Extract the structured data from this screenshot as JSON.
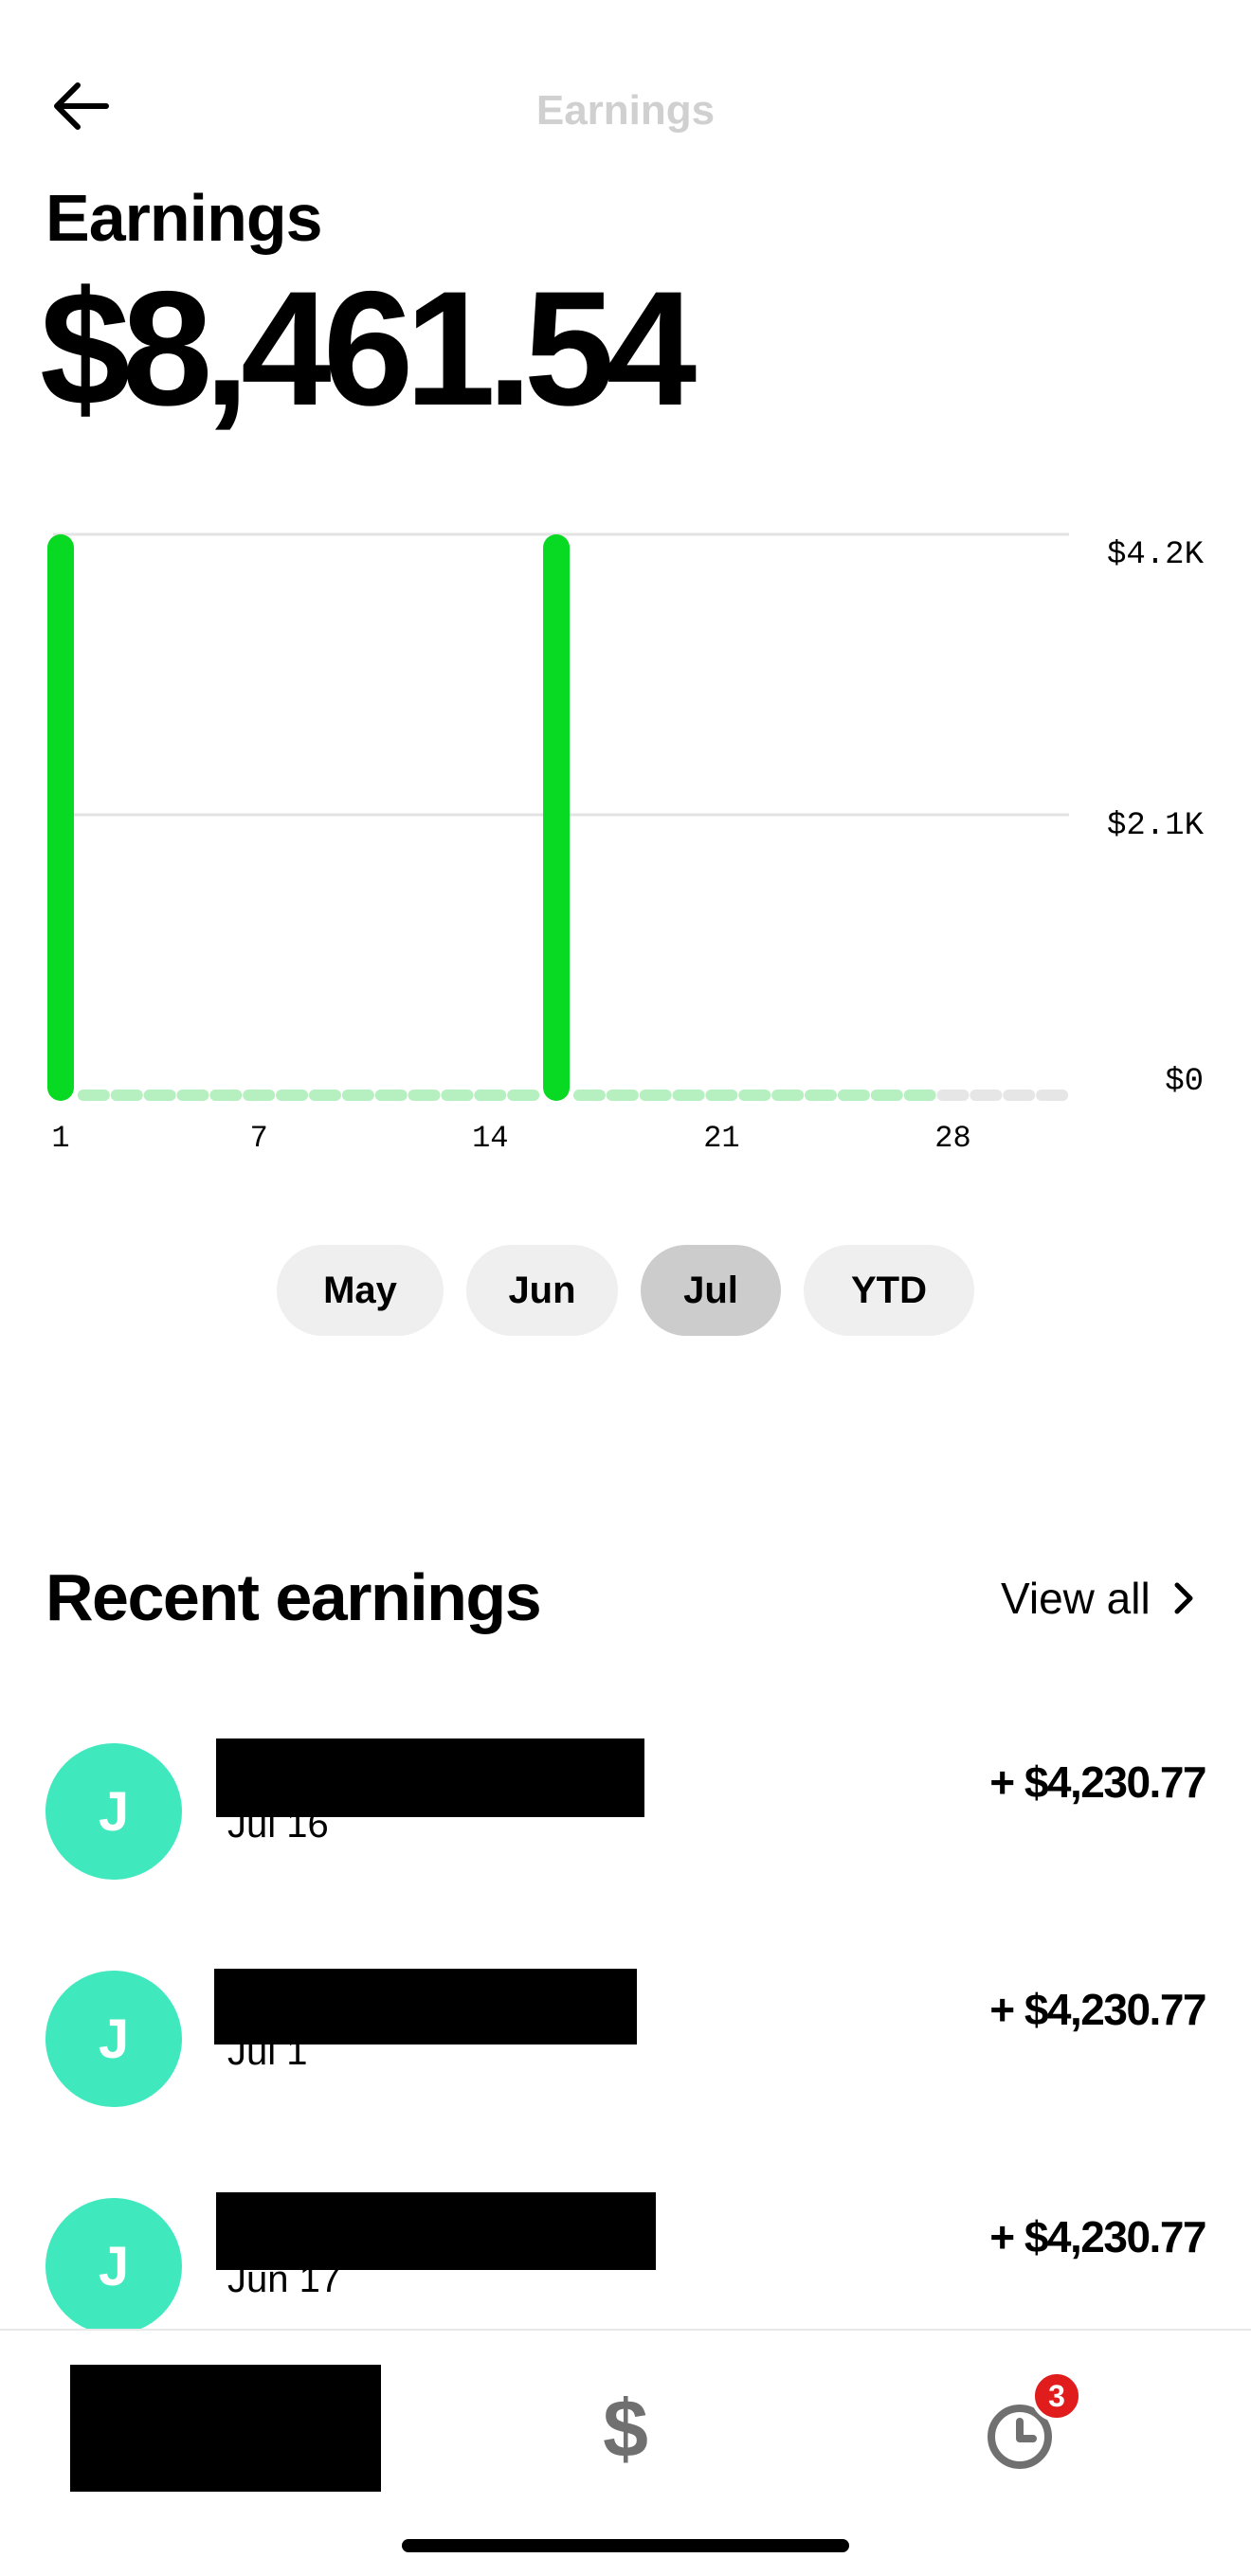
{
  "header": {
    "title": "Earnings"
  },
  "summary": {
    "label": "Earnings",
    "total": "$8,461.54"
  },
  "colors": {
    "bar": "#08d922",
    "bar_future_dash": "#b6f0c0",
    "dash_empty": "#e6e6e6",
    "avatar": "#40e8be",
    "badge": "#e01c1c"
  },
  "chart_data": {
    "type": "bar",
    "x": [
      1,
      16
    ],
    "values": [
      4230.77,
      4230.77
    ],
    "days_in_month": 31,
    "days_elapsed": 27,
    "xticks": [
      "1",
      "7",
      "14",
      "21",
      "28"
    ],
    "yticks": [
      "$4.2K",
      "$2.1K",
      "$0"
    ],
    "ylim": [
      0,
      4230.77
    ],
    "grid": true
  },
  "periods": [
    {
      "label": "May",
      "active": false
    },
    {
      "label": "Jun",
      "active": false
    },
    {
      "label": "Jul",
      "active": true
    },
    {
      "label": "YTD",
      "active": false
    }
  ],
  "recent": {
    "title": "Recent earnings",
    "view_all": "View all",
    "items": [
      {
        "initial": "J",
        "date": "Jul 16",
        "amount": "+ $4,230.77"
      },
      {
        "initial": "J",
        "date": "Jul 1",
        "amount": "+ $4,230.77"
      },
      {
        "initial": "J",
        "date": "Jun 17",
        "amount": "+ $4,230.77"
      }
    ]
  },
  "nav": {
    "dollar_symbol": "$",
    "badge_count": "3"
  },
  "icons": {
    "back": "arrow-left-icon",
    "chevron": "chevron-right-icon",
    "dollar": "dollar-icon",
    "activity": "clock-icon"
  }
}
